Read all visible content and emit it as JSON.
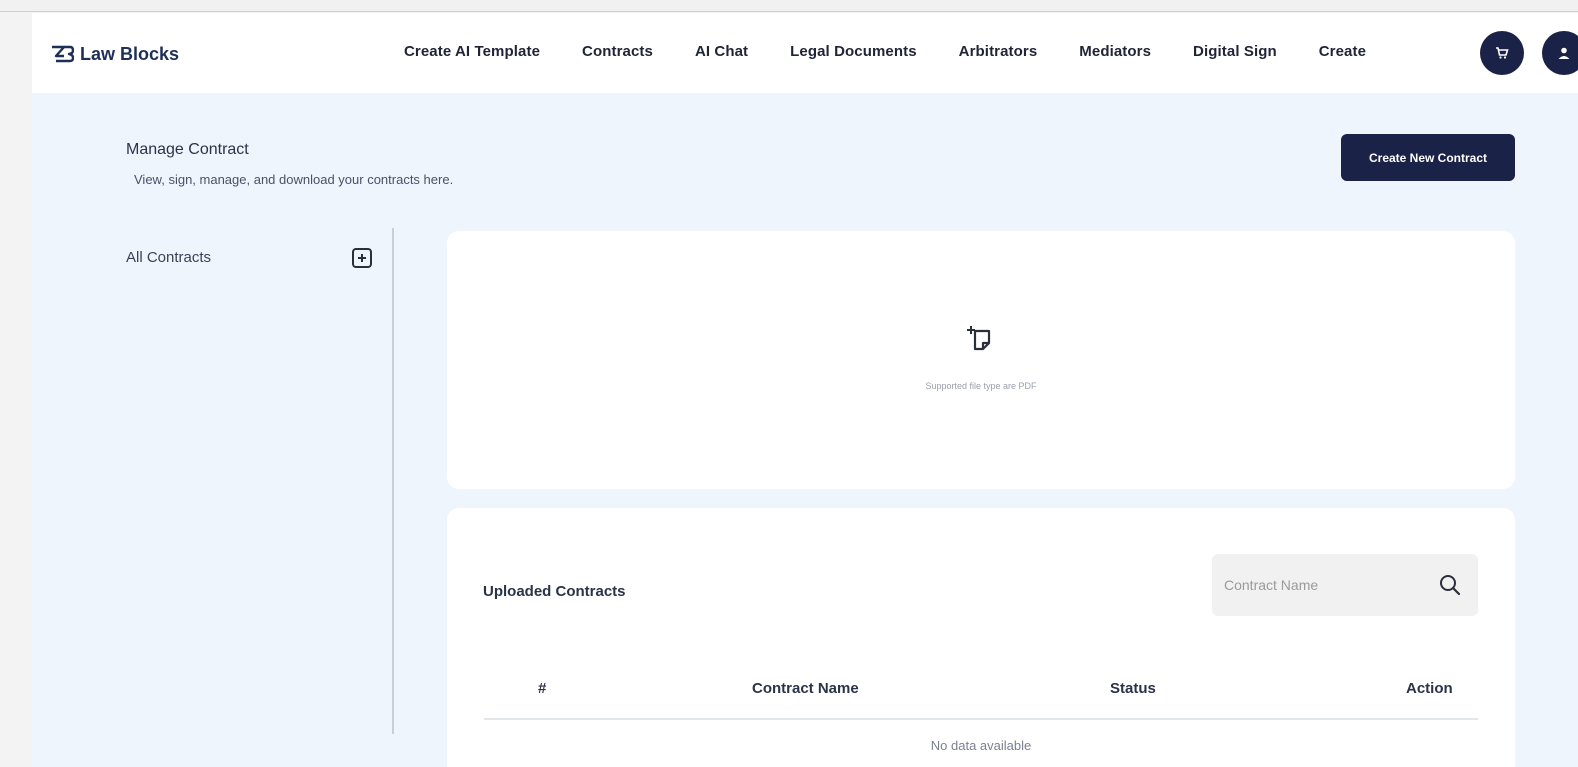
{
  "brand": {
    "name": "Law Blocks",
    "icon": "law-blocks-logo-icon"
  },
  "nav": {
    "links": [
      "Create AI Template",
      "Contracts",
      "AI Chat",
      "Legal Documents",
      "Arbitrators",
      "Mediators",
      "Digital Sign",
      "Create"
    ],
    "icons": [
      "cart-icon",
      "user-icon"
    ]
  },
  "header": {
    "title": "Manage Contract",
    "subtitle": "View, sign, manage, and download your contracts here.",
    "create_button": "Create New Contract"
  },
  "sidebar": {
    "label": "All Contracts",
    "add_icon": "plus-square-icon"
  },
  "upload": {
    "icon": "upload-file-icon",
    "hint": "Supported file type are PDF"
  },
  "uploaded": {
    "title": "Uploaded Contracts",
    "search_placeholder": "Contract Name",
    "columns": [
      "#",
      "Contract Name",
      "Status",
      "Action"
    ],
    "empty_text": "No data available"
  },
  "colors": {
    "primary": "#1a2247",
    "page_bg": "#eef5fc",
    "card_bg": "#ffffff"
  }
}
